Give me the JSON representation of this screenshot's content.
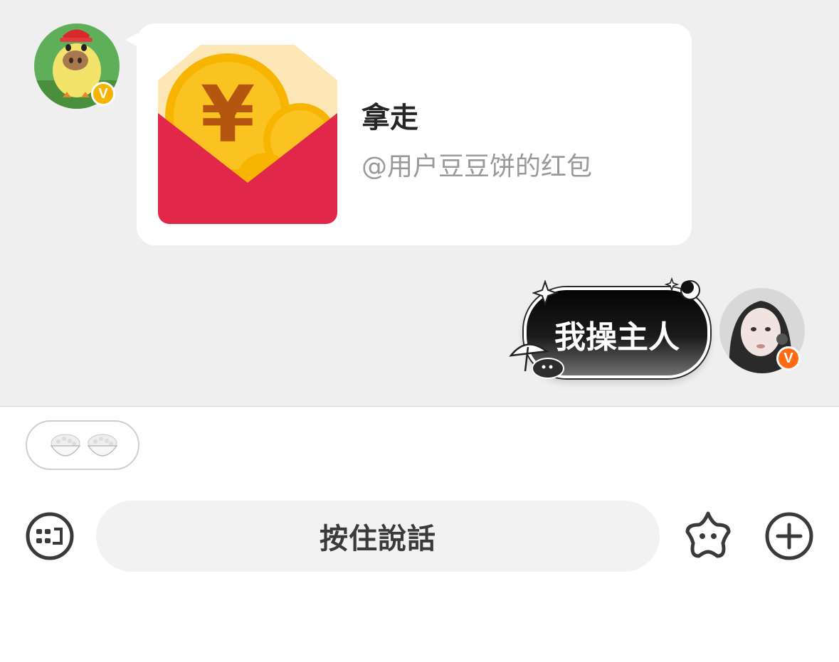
{
  "messages": [
    {
      "type": "red_packet",
      "sender": "left",
      "title": "拿走",
      "subtitle": "@用户豆豆饼的红包",
      "avatar_icon": "chick-avatar",
      "badge": "V",
      "badge_color": "#f5b400"
    },
    {
      "type": "sticker_text",
      "sender": "right",
      "text": "我操主人",
      "avatar_icon": "girl-avatar",
      "badge": "V",
      "badge_color": "#ff6a13"
    }
  ],
  "quick_reply": {
    "icons": [
      "rice-bowl-icon",
      "rice-bowl-icon"
    ]
  },
  "input_bar": {
    "voice_label": "按住說話",
    "left_icon": "keyboard-icon",
    "emoji_icon": "star-face-icon",
    "plus_icon": "plus-circle-icon"
  },
  "colors": {
    "chat_bg": "#efefef",
    "bubble_bg": "#ffffff",
    "red_packet_red": "#e1284b",
    "coin_gold": "#f7b500"
  }
}
